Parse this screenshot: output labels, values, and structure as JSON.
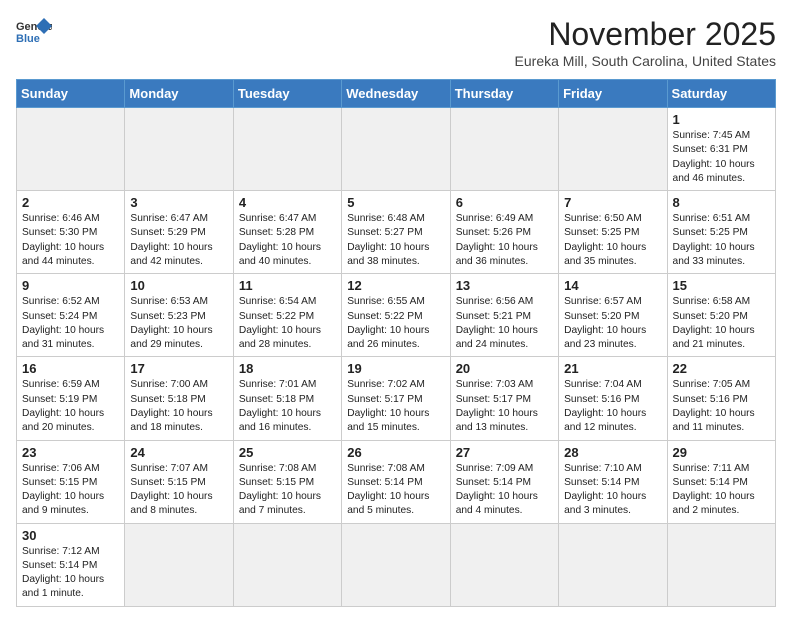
{
  "header": {
    "logo_general": "General",
    "logo_blue": "Blue",
    "month": "November 2025",
    "location": "Eureka Mill, South Carolina, United States"
  },
  "weekdays": [
    "Sunday",
    "Monday",
    "Tuesday",
    "Wednesday",
    "Thursday",
    "Friday",
    "Saturday"
  ],
  "weeks": [
    [
      {
        "day": "",
        "info": ""
      },
      {
        "day": "",
        "info": ""
      },
      {
        "day": "",
        "info": ""
      },
      {
        "day": "",
        "info": ""
      },
      {
        "day": "",
        "info": ""
      },
      {
        "day": "",
        "info": ""
      },
      {
        "day": "1",
        "info": "Sunrise: 7:45 AM\nSunset: 6:31 PM\nDaylight: 10 hours\nand 46 minutes."
      }
    ],
    [
      {
        "day": "2",
        "info": "Sunrise: 6:46 AM\nSunset: 5:30 PM\nDaylight: 10 hours\nand 44 minutes."
      },
      {
        "day": "3",
        "info": "Sunrise: 6:47 AM\nSunset: 5:29 PM\nDaylight: 10 hours\nand 42 minutes."
      },
      {
        "day": "4",
        "info": "Sunrise: 6:47 AM\nSunset: 5:28 PM\nDaylight: 10 hours\nand 40 minutes."
      },
      {
        "day": "5",
        "info": "Sunrise: 6:48 AM\nSunset: 5:27 PM\nDaylight: 10 hours\nand 38 minutes."
      },
      {
        "day": "6",
        "info": "Sunrise: 6:49 AM\nSunset: 5:26 PM\nDaylight: 10 hours\nand 36 minutes."
      },
      {
        "day": "7",
        "info": "Sunrise: 6:50 AM\nSunset: 5:25 PM\nDaylight: 10 hours\nand 35 minutes."
      },
      {
        "day": "8",
        "info": "Sunrise: 6:51 AM\nSunset: 5:25 PM\nDaylight: 10 hours\nand 33 minutes."
      }
    ],
    [
      {
        "day": "9",
        "info": "Sunrise: 6:52 AM\nSunset: 5:24 PM\nDaylight: 10 hours\nand 31 minutes."
      },
      {
        "day": "10",
        "info": "Sunrise: 6:53 AM\nSunset: 5:23 PM\nDaylight: 10 hours\nand 29 minutes."
      },
      {
        "day": "11",
        "info": "Sunrise: 6:54 AM\nSunset: 5:22 PM\nDaylight: 10 hours\nand 28 minutes."
      },
      {
        "day": "12",
        "info": "Sunrise: 6:55 AM\nSunset: 5:22 PM\nDaylight: 10 hours\nand 26 minutes."
      },
      {
        "day": "13",
        "info": "Sunrise: 6:56 AM\nSunset: 5:21 PM\nDaylight: 10 hours\nand 24 minutes."
      },
      {
        "day": "14",
        "info": "Sunrise: 6:57 AM\nSunset: 5:20 PM\nDaylight: 10 hours\nand 23 minutes."
      },
      {
        "day": "15",
        "info": "Sunrise: 6:58 AM\nSunset: 5:20 PM\nDaylight: 10 hours\nand 21 minutes."
      }
    ],
    [
      {
        "day": "16",
        "info": "Sunrise: 6:59 AM\nSunset: 5:19 PM\nDaylight: 10 hours\nand 20 minutes."
      },
      {
        "day": "17",
        "info": "Sunrise: 7:00 AM\nSunset: 5:18 PM\nDaylight: 10 hours\nand 18 minutes."
      },
      {
        "day": "18",
        "info": "Sunrise: 7:01 AM\nSunset: 5:18 PM\nDaylight: 10 hours\nand 16 minutes."
      },
      {
        "day": "19",
        "info": "Sunrise: 7:02 AM\nSunset: 5:17 PM\nDaylight: 10 hours\nand 15 minutes."
      },
      {
        "day": "20",
        "info": "Sunrise: 7:03 AM\nSunset: 5:17 PM\nDaylight: 10 hours\nand 13 minutes."
      },
      {
        "day": "21",
        "info": "Sunrise: 7:04 AM\nSunset: 5:16 PM\nDaylight: 10 hours\nand 12 minutes."
      },
      {
        "day": "22",
        "info": "Sunrise: 7:05 AM\nSunset: 5:16 PM\nDaylight: 10 hours\nand 11 minutes."
      }
    ],
    [
      {
        "day": "23",
        "info": "Sunrise: 7:06 AM\nSunset: 5:15 PM\nDaylight: 10 hours\nand 9 minutes."
      },
      {
        "day": "24",
        "info": "Sunrise: 7:07 AM\nSunset: 5:15 PM\nDaylight: 10 hours\nand 8 minutes."
      },
      {
        "day": "25",
        "info": "Sunrise: 7:08 AM\nSunset: 5:15 PM\nDaylight: 10 hours\nand 7 minutes."
      },
      {
        "day": "26",
        "info": "Sunrise: 7:08 AM\nSunset: 5:14 PM\nDaylight: 10 hours\nand 5 minutes."
      },
      {
        "day": "27",
        "info": "Sunrise: 7:09 AM\nSunset: 5:14 PM\nDaylight: 10 hours\nand 4 minutes."
      },
      {
        "day": "28",
        "info": "Sunrise: 7:10 AM\nSunset: 5:14 PM\nDaylight: 10 hours\nand 3 minutes."
      },
      {
        "day": "29",
        "info": "Sunrise: 7:11 AM\nSunset: 5:14 PM\nDaylight: 10 hours\nand 2 minutes."
      }
    ],
    [
      {
        "day": "30",
        "info": "Sunrise: 7:12 AM\nSunset: 5:14 PM\nDaylight: 10 hours\nand 1 minute."
      },
      {
        "day": "",
        "info": ""
      },
      {
        "day": "",
        "info": ""
      },
      {
        "day": "",
        "info": ""
      },
      {
        "day": "",
        "info": ""
      },
      {
        "day": "",
        "info": ""
      },
      {
        "day": "",
        "info": ""
      }
    ]
  ]
}
